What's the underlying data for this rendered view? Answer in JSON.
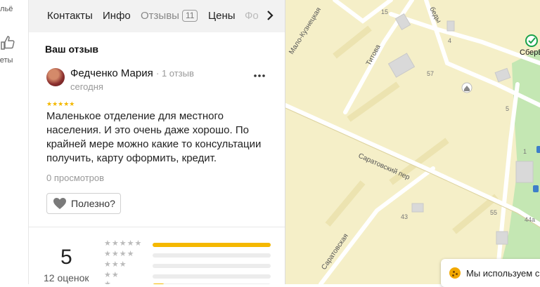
{
  "edge": {
    "top_text": "ильё",
    "bottom_text": "веты"
  },
  "tabs": [
    {
      "label": "Контакты"
    },
    {
      "label": "Инфо"
    },
    {
      "label": "Отзывы",
      "count": "11"
    },
    {
      "label": "Цены"
    },
    {
      "label": "Фо"
    }
  ],
  "review": {
    "section_title": "Ваш отзыв",
    "author": "Федченко Мария",
    "author_meta": "· 1 отзыв",
    "date": "сегодня",
    "rating": 5,
    "stars": "★★★★★",
    "text": "Маленькое отделение для местного населения. И это очень даже хорошо. По крайней мере можно какие то консультации получить, карту оформить, кредит.",
    "views": "0 просмотров",
    "useful_label": "Полезно?"
  },
  "summary": {
    "score": "5",
    "count": "12 оценок",
    "rows": [
      {
        "stars": "★★★★★",
        "fraction": 1.0
      },
      {
        "stars": "★★★★",
        "fraction": 0.0
      },
      {
        "stars": "★★★",
        "fraction": 0.0
      },
      {
        "stars": "★★",
        "fraction": 0.0
      },
      {
        "stars": "★",
        "fraction": 0.1
      }
    ]
  },
  "map": {
    "streets": [
      "Мало-Кузнецкая",
      "Титова",
      "Саратовский пер",
      "Саратовская",
      "беды"
    ],
    "numbers": [
      "15",
      "4",
      "57",
      "5",
      "1",
      "43",
      "55",
      "44а"
    ],
    "poi_label": "СберБ"
  },
  "cookie": {
    "text": "Мы используем с"
  },
  "colors": {
    "accent": "#f5b800",
    "map_bg": "#f5efc8",
    "map_green": "#c4e7b3"
  }
}
